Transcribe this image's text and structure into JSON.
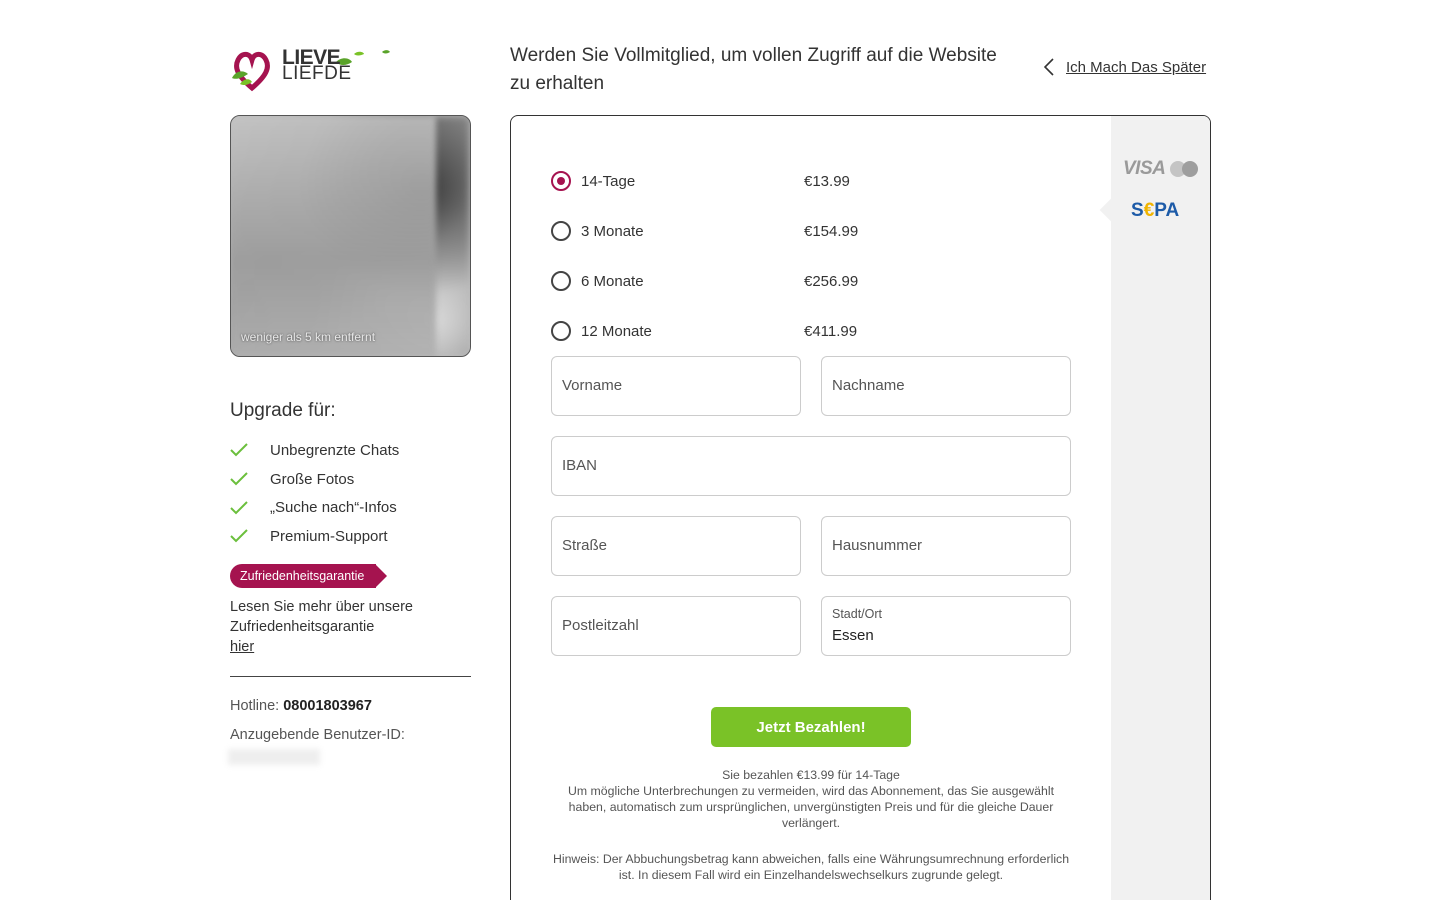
{
  "logo": {
    "line1": "LIEVE",
    "line2": "LIEFDE"
  },
  "profile": {
    "distance": "weniger als 5 km entfernt"
  },
  "upgrade": {
    "title": "Upgrade für:",
    "benefits": [
      "Unbegrenzte Chats",
      "Große Fotos",
      "„Suche nach“-Infos",
      "Premium-Support"
    ]
  },
  "guarantee": {
    "tag": "Zufriedenheitsgarantie",
    "text": "Lesen Sie mehr über unsere Zufriedenheitsgarantie",
    "link": "hier"
  },
  "contact": {
    "hotline_label": "Hotline:",
    "hotline_number": "08001803967",
    "userid_label": "Anzugebende Benutzer-ID:"
  },
  "header": {
    "title": "Werden Sie Vollmitglied, um vollen Zugriff auf die Website zu erhalten",
    "later": "Ich Mach Das Später"
  },
  "payment_methods": {
    "card": "VISA",
    "sepa_s": "S",
    "sepa_e": "€",
    "sepa_pa": "PA"
  },
  "plans": [
    {
      "name": "14-Tage",
      "price": "€13.99",
      "selected": true
    },
    {
      "name": "3 Monate",
      "price": "€154.99",
      "selected": false
    },
    {
      "name": "6 Monate",
      "price": "€256.99",
      "selected": false
    },
    {
      "name": "12 Monate",
      "price": "€411.99",
      "selected": false
    }
  ],
  "form": {
    "first_name": "Vorname",
    "last_name": "Nachname",
    "iban": "IBAN",
    "street": "Straße",
    "house_number": "Hausnummer",
    "postal_code": "Postleitzahl",
    "city_label": "Stadt/Ort",
    "city_value": "Essen"
  },
  "pay_button": "Jetzt Bezahlen!",
  "summary": {
    "line1": "Sie bezahlen €13.99 für 14-Tage",
    "line2": "Um mögliche Unterbrechungen zu vermeiden, wird das Abonnement, das Sie ausgewählt haben, automatisch zum ursprünglichen, unvergünstigten Preis und für die gleiche Dauer verlängert."
  },
  "note": "Hinweis: Der Abbuchungsbetrag kann abweichen, falls eine Währungsumrechnung erforderlich ist. In diesem Fall wird ein Einzelhandelswechselkurs zugrunde gelegt.",
  "colors": {
    "brand": "#a5134f",
    "pay_button": "#7ac227",
    "check": "#6bbf3c",
    "sepa_blue": "#1d5ba8",
    "sepa_yellow": "#f0b400"
  }
}
